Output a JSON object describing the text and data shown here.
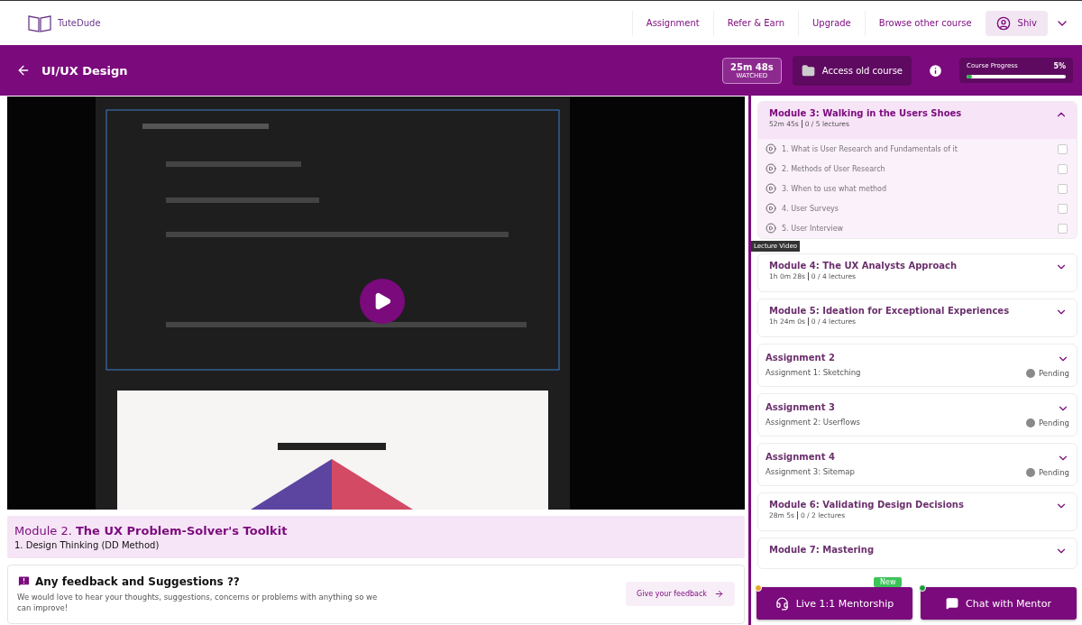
{
  "brand": {
    "name": "TuteDude"
  },
  "nav": {
    "links": [
      "Assignment",
      "Refer & Earn",
      "Upgrade",
      "Browse other course"
    ],
    "user": "Shiv"
  },
  "course_bar": {
    "title": "UI/UX Design",
    "watched": {
      "time": "25m 48s",
      "label": "WATCHED"
    },
    "old_course": "Access old course",
    "progress": {
      "label": "Course Progress",
      "reading": "5%",
      "level": 0.05
    }
  },
  "lesson": {
    "module": "Module 2.",
    "module_title": "The UX Problem-Solver's Toolkit",
    "lecture": "1. Design Thinking (DD Method)"
  },
  "feedback": {
    "title": "Any feedback and Suggestions ??",
    "text": "We would love to hear your thoughts, suggestions, concerns or problems with anything so we can improve!",
    "button": "Give your feedback"
  },
  "sidebar": {
    "items": [
      {
        "kind": "module",
        "title": "Module 3: Walking in the Users Shoes",
        "duration": "52m 45s",
        "count": "0 / 5 lectures",
        "expanded": true,
        "lectures": [
          {
            "title": "1. What is User Research and Fundamentals of it",
            "checked": false
          },
          {
            "title": "2. Methods of User Research",
            "checked": false
          },
          {
            "title": "3. When to use what method",
            "checked": false
          },
          {
            "title": "4. User Surveys",
            "checked": false
          },
          {
            "title": "5. User Interview",
            "checked": false
          }
        ]
      },
      {
        "kind": "module",
        "title": "Module 4: The UX Analysts Approach",
        "duration": "1h 0m 28s",
        "count": "0 / 4 lectures",
        "expanded": false
      },
      {
        "kind": "module",
        "title": "Module 5: Ideation for Exceptional Experiences",
        "duration": "1h 24m 0s",
        "count": "0 / 4 lectures",
        "expanded": false
      },
      {
        "kind": "assignment",
        "title": "Assignment 2",
        "subtitle": "Assignment 1: Sketching",
        "status": "Pending",
        "color": "#8a8a8a"
      },
      {
        "kind": "assignment",
        "title": "Assignment 3",
        "subtitle": "Assignment 2: Userflows",
        "status": "Pending",
        "color": "#8a8a8a"
      },
      {
        "kind": "assignment",
        "title": "Assignment 4",
        "subtitle": "Assignment 3: Sitemap",
        "status": "Pending",
        "color": "#8a8a8a"
      },
      {
        "kind": "module",
        "title": "Module 6: Validating Design Decisions",
        "duration": "28m 5s",
        "count": "0 / 2 lectures",
        "expanded": false
      },
      {
        "kind": "module",
        "title": "Module 7: Mastering",
        "expanded": false
      }
    ]
  },
  "tooltip": "Lecture Video",
  "actions": [
    {
      "label": "Live 1:1 Mentorship",
      "badge": "New",
      "color": "#e6a82a"
    },
    {
      "label": "Chat with Mentor",
      "color": "#1e9a3a"
    }
  ]
}
